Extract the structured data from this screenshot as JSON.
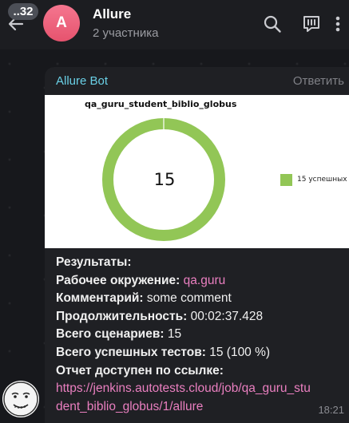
{
  "header": {
    "unread_count": "..32",
    "avatar_letter": "A",
    "title": "Allure",
    "subtitle": "2 участника"
  },
  "message": {
    "sender": "Allure Bot",
    "reply_label": "Ответить",
    "time": "18:21",
    "lines": [
      {
        "label": "Результаты:",
        "value": ""
      },
      {
        "label": "Рабочее окружение:",
        "value": "qa.guru",
        "is_link": true
      },
      {
        "label": "Комментарий:",
        "value": "some comment"
      },
      {
        "label": "Продолжительность:",
        "value": "00:02:37.428"
      },
      {
        "label": "Всего сценариев:",
        "value": "15"
      },
      {
        "label": "Всего успешных тестов:",
        "value": "15 (100 %)"
      },
      {
        "label": "Отчет доступен по ссылке:",
        "value": ""
      }
    ],
    "report_link_line1": "https://jenkins.autotests.cloud/job/qa_guru_stu",
    "report_link_line2": "dent_biblio_globus/1/allure"
  },
  "chart_data": {
    "type": "pie",
    "title": "qa_guru_student_biblio_globus",
    "center_label": "15",
    "slices": [
      {
        "label": "15 успешных",
        "value": 15,
        "color": "#92c656"
      }
    ],
    "legend_position": "right"
  },
  "colors": {
    "link": "#ea7fc0",
    "sender": "#6ad0e6",
    "avatar": "#e6536e",
    "passed": "#92c656"
  }
}
